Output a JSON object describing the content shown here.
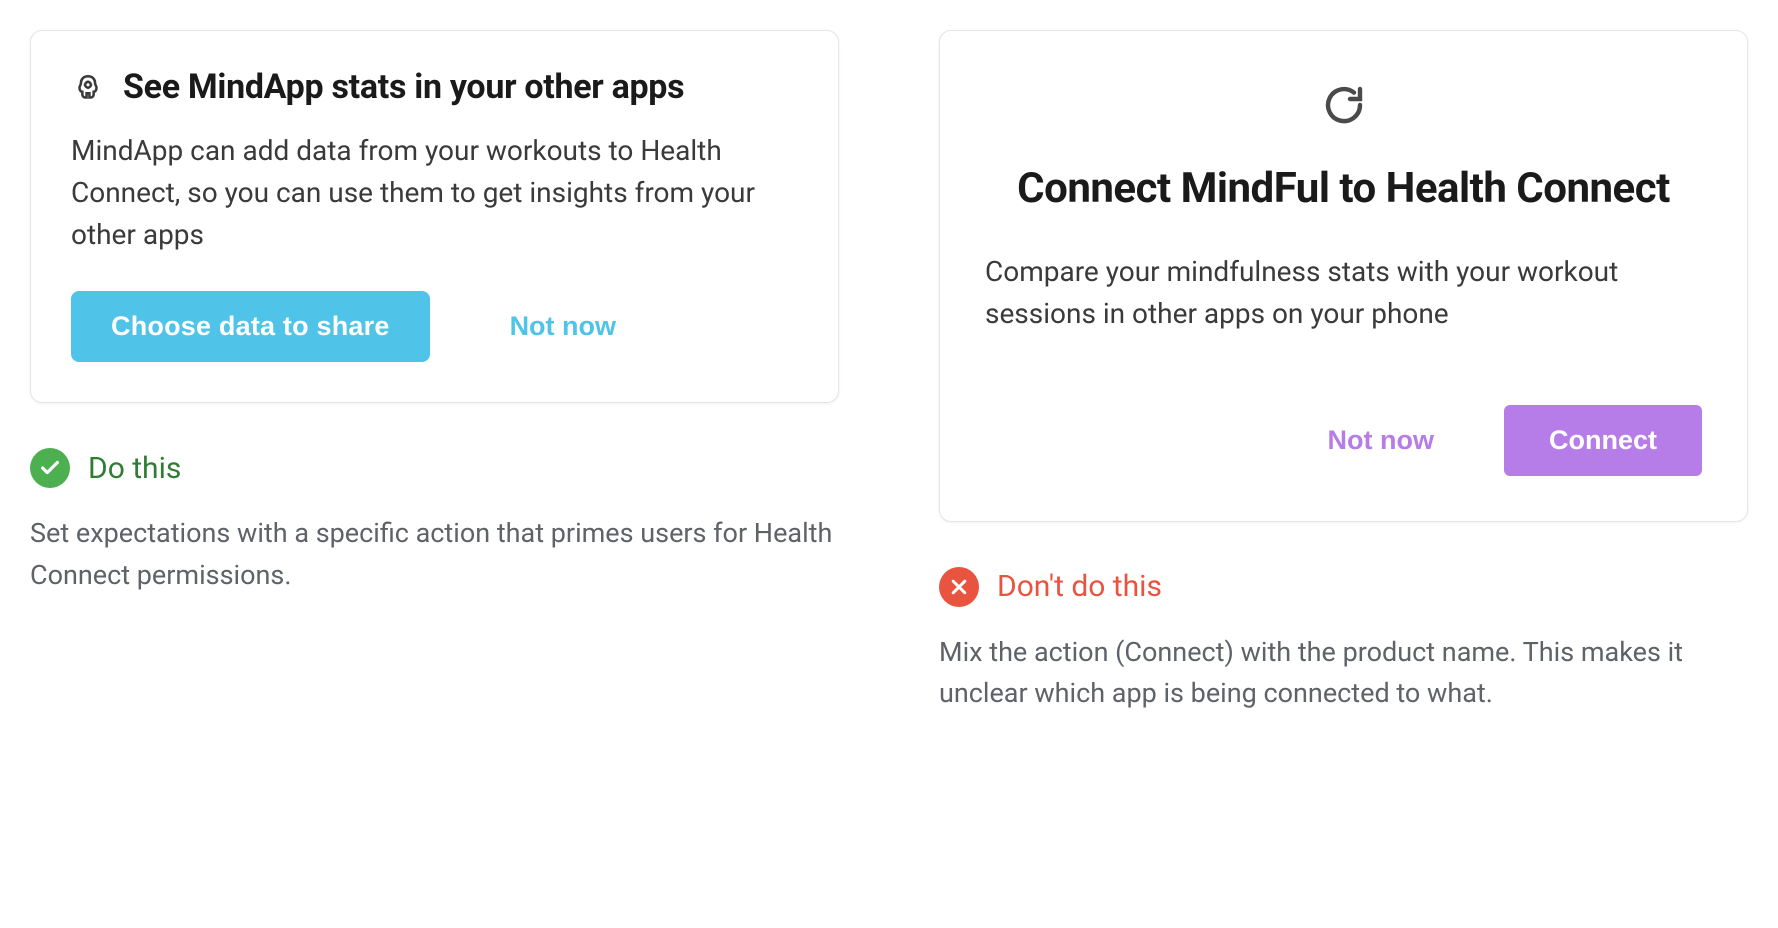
{
  "left": {
    "card": {
      "title": "See MindApp stats in your other apps",
      "body": "MindApp can add data from your workouts to Health Connect, so you can use them to get insights from your other apps",
      "primary_button": "Choose data to share",
      "secondary_button": "Not now"
    },
    "annotation": {
      "label": "Do this",
      "text": "Set expectations with a specific action that primes users for Health Connect permissions."
    }
  },
  "right": {
    "card": {
      "title": "Connect MindFul to Health Connect",
      "body": "Compare your mindfulness stats with your workout sessions in other apps on your phone",
      "secondary_button": "Not now",
      "primary_button": "Connect"
    },
    "annotation": {
      "label": "Don't do this",
      "text": "Mix the action (Connect) with the product name. This makes it unclear which app is being connected to what."
    }
  }
}
